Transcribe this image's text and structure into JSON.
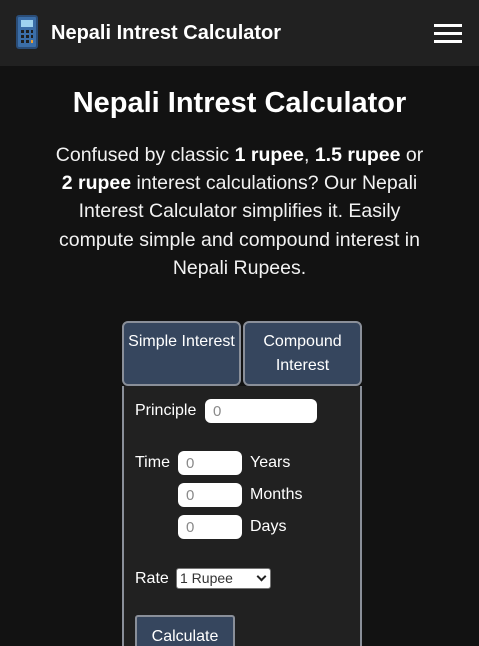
{
  "navbar": {
    "title": "Nepali Intrest Calculator",
    "brand_icon": "calculator-icon",
    "menu_icon": "hamburger-menu-icon"
  },
  "page": {
    "title": "Nepali Intrest Calculator",
    "intro": {
      "p1": "Confused by classic ",
      "b1": "1 rupee",
      "p2": ", ",
      "b2": "1.5 rupee",
      "p3": " or ",
      "b3": "2 rupee",
      "p4": " interest calculations? Our Nepali Interest Calculator simplifies it. Easily compute simple and compound interest in Nepali Rupees."
    }
  },
  "tabs": {
    "simple": "Simple Interest",
    "compound": "Compound Interest"
  },
  "form": {
    "principal_label": "Principle",
    "principal_placeholder": "0",
    "time_label": "Time",
    "years_placeholder": "0",
    "years_label": "Years",
    "months_placeholder": "0",
    "months_label": "Months",
    "days_placeholder": "0",
    "days_label": "Days",
    "rate_label": "Rate",
    "rate_selected": "1 Rupee",
    "calculate_label": "Calculate"
  },
  "colors": {
    "background": "#121212",
    "navbar": "#212121",
    "accent": "#36465e",
    "border": "#8a8f99"
  }
}
